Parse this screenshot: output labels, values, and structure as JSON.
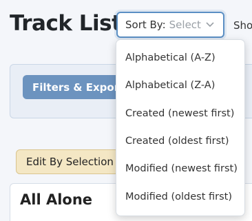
{
  "page": {
    "title": "Track List"
  },
  "sort": {
    "prefix": "Sort By:",
    "placeholder": "Select",
    "options": [
      "Alphabetical (A-Z)",
      "Alphabetical (Z-A)",
      "Created (newest first)",
      "Created (oldest first)",
      "Modified (newest first)",
      "Modified (oldest first)"
    ]
  },
  "show_label": "Sho",
  "filters": {
    "button_label": "Filters & Export"
  },
  "edit": {
    "button_label": "Edit By Selection"
  },
  "track": {
    "title": "All Alone"
  }
}
